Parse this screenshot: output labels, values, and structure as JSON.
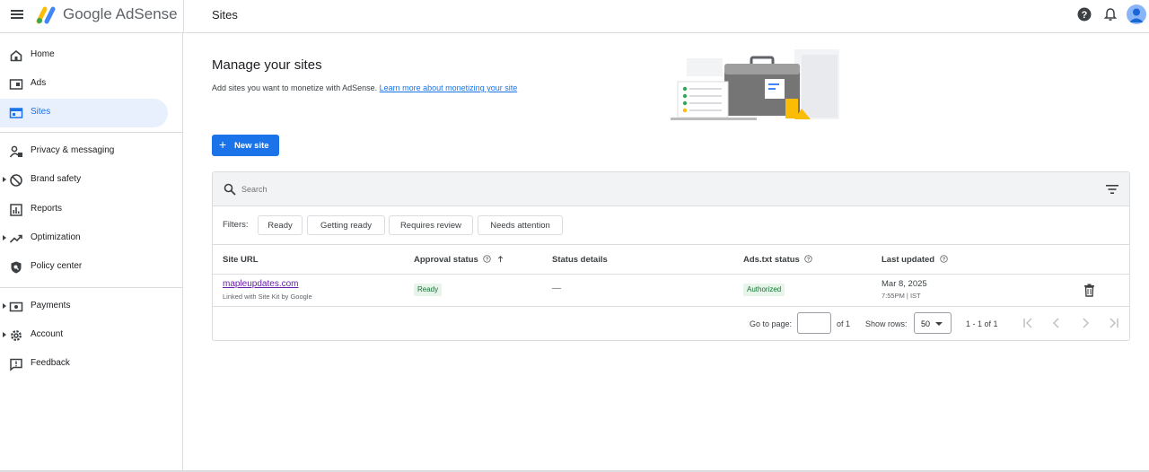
{
  "app": {
    "brand": "Google AdSense",
    "page_title": "Sites"
  },
  "topbar": {
    "menu_icon": "hamburger-menu-icon",
    "help_icon": "help-circle-icon",
    "notifications_icon": "bell-icon",
    "avatar_icon": "account-avatar-icon"
  },
  "sidebar": {
    "items": [
      {
        "label": "Home",
        "icon": "home-icon",
        "expandable": false,
        "active": false
      },
      {
        "label": "Ads",
        "icon": "ads-icon",
        "expandable": false,
        "active": false
      },
      {
        "label": "Sites",
        "icon": "sites-icon",
        "expandable": false,
        "active": true
      },
      {
        "label": "Privacy & messaging",
        "icon": "privacy-icon",
        "expandable": false,
        "active": false
      },
      {
        "label": "Brand safety",
        "icon": "block-icon",
        "expandable": true,
        "active": false
      },
      {
        "label": "Reports",
        "icon": "reports-icon",
        "expandable": false,
        "active": false
      },
      {
        "label": "Optimization",
        "icon": "trending-icon",
        "expandable": true,
        "active": false
      },
      {
        "label": "Policy center",
        "icon": "policy-shield-icon",
        "expandable": false,
        "active": false
      },
      {
        "label": "Payments",
        "icon": "payments-icon",
        "expandable": true,
        "active": false
      },
      {
        "label": "Account",
        "icon": "gear-icon",
        "expandable": true,
        "active": false
      },
      {
        "label": "Feedback",
        "icon": "feedback-icon",
        "expandable": false,
        "active": false
      }
    ]
  },
  "main": {
    "title": "Manage your sites",
    "description": "Add sites you want to monetize with AdSense.",
    "learn_more": "Learn more about monetizing your site",
    "new_site_button": "New site"
  },
  "table": {
    "search_placeholder": "Search",
    "filters_label": "Filters:",
    "filters": [
      "Ready",
      "Getting ready",
      "Requires review",
      "Needs attention"
    ],
    "columns": {
      "site_url": "Site URL",
      "approval_status": "Approval status",
      "status_details": "Status details",
      "ads_txt_status": "Ads.txt status",
      "last_updated": "Last updated"
    },
    "rows": [
      {
        "site": "mapleupdates.com",
        "site_sub": "Linked with Site Kit by Google",
        "approval": "Ready",
        "details": "—",
        "ads_txt": "Authorized",
        "date": "Mar 8, 2025",
        "time": "7:55PM | IST"
      }
    ],
    "pagination": {
      "go_to_page": "Go to page:",
      "of_pages": "of 1",
      "show_rows_label": "Show rows:",
      "rows_per_page": "50",
      "range": "1 - 1 of 1"
    }
  },
  "colors": {
    "accent": "#1a73e8",
    "active_bg": "#e8f0fe",
    "ready_bg": "#e6f4ea",
    "ready_text": "#137333",
    "visited_link": "#681da8"
  }
}
